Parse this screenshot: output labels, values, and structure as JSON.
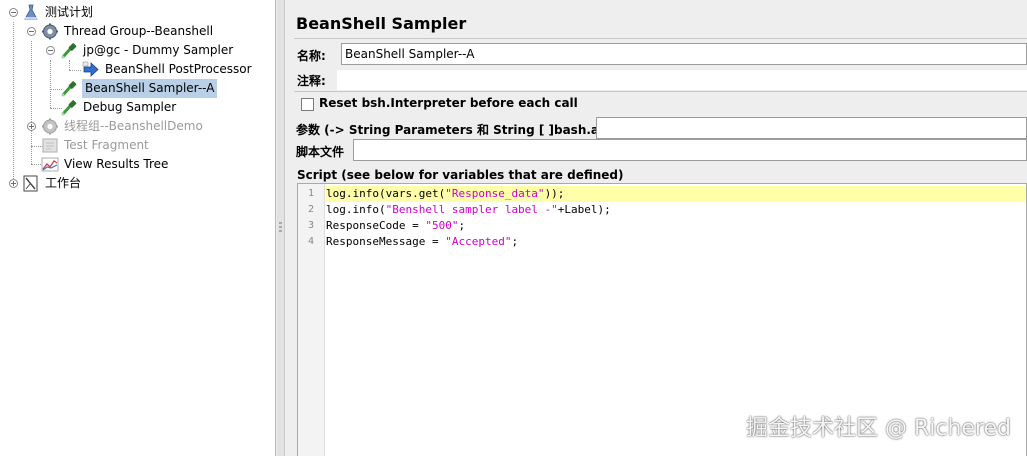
{
  "tree": {
    "nodes": [
      {
        "label": "测试计划",
        "icon": "test-plan-icon"
      },
      {
        "label": "Thread Group--Beanshell",
        "icon": "thread-group-gear-icon"
      },
      {
        "label": "jp@gc - Dummy Sampler",
        "icon": "sampler-pipette-icon"
      },
      {
        "label": "BeanShell PostProcessor",
        "icon": "postprocessor-arrow-icon"
      },
      {
        "label": "BeanShell Sampler--A",
        "icon": "sampler-pipette-icon",
        "selected": true
      },
      {
        "label": "Debug Sampler",
        "icon": "sampler-pipette-icon"
      },
      {
        "label": "线程组--BeanshellDemo",
        "icon": "thread-group-gear-icon",
        "disabled": true
      },
      {
        "label": "Test Fragment",
        "icon": "fragment-icon",
        "disabled": true
      },
      {
        "label": "View Results Tree",
        "icon": "listener-graph-icon"
      },
      {
        "label": "工作台",
        "icon": "workbench-icon"
      }
    ]
  },
  "editor": {
    "title": "BeanShell Sampler",
    "name_label": "名称:",
    "name_value": "BeanShell Sampler--A",
    "comments_label": "注释:",
    "comments_value": "",
    "reset_label": "Reset bsh.Interpreter before each call",
    "reset_checked": false,
    "params_label": "参数 (-> String Parameters 和 String [ ]bash.args)",
    "params_value": "",
    "script_file_label": "脚本文件",
    "script_file_value": "",
    "script_label": "Script (see below for variables that are defined)",
    "script_lines": [
      {
        "no": "1",
        "code": "log.info(vars.get(\"Response_data\"));"
      },
      {
        "no": "2",
        "code": "log.info(\"Benshell sampler label -\"+Label);"
      },
      {
        "no": "3",
        "code": "ResponseCode = \"500\";"
      },
      {
        "no": "4",
        "code": "ResponseMessage = \"Accepted\";"
      }
    ]
  },
  "watermark": "掘金技术社区 @ Richered",
  "colors": {
    "selection": "#b8cfe5",
    "current_line": "#ffffaa",
    "string_literal": "#cc00cc",
    "panel_bg": "#eeeeee"
  }
}
